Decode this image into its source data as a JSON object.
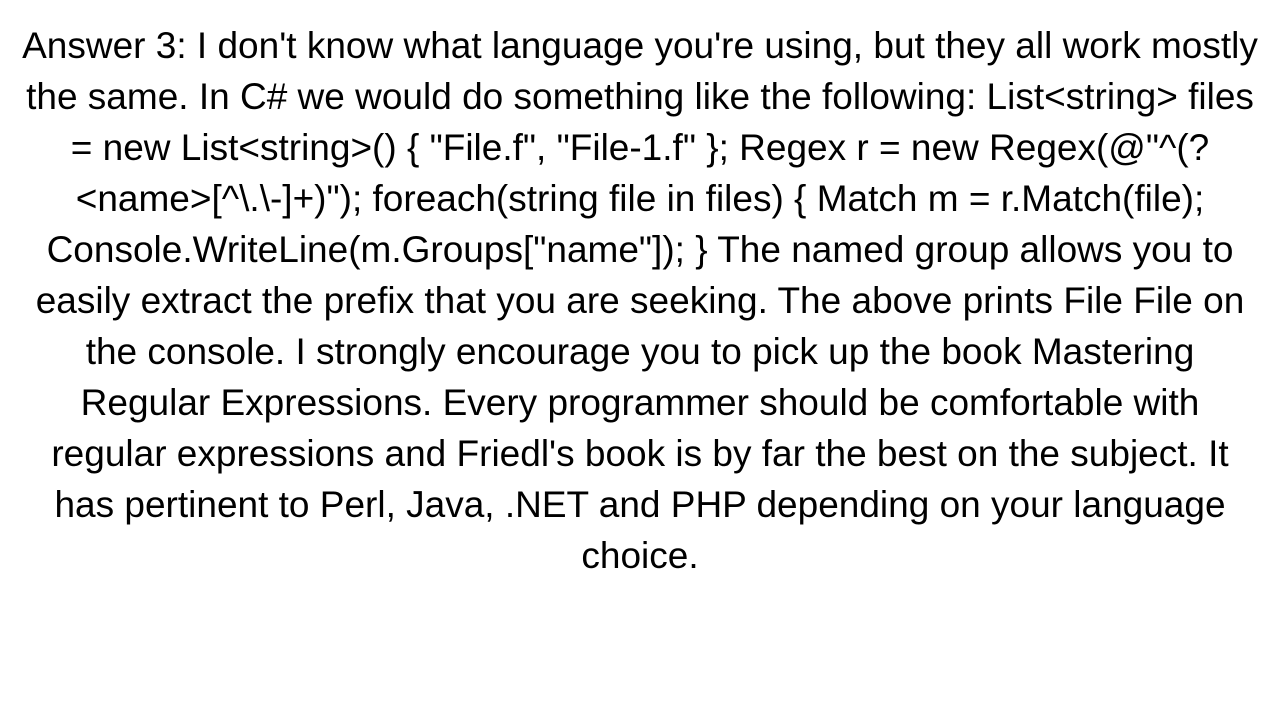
{
  "answer": {
    "text": "Answer 3: I don't know what language you're using, but they all work mostly the same. In C# we would do something like the following: List<string> files = new List<string>() { \"File.f\",     \"File-1.f\" }; Regex r = new Regex(@\"^(?<name>[^\\.\\-]+)\"); foreach(string file in files) {     Match m = r.Match(file);     Console.WriteLine(m.Groups[\"name\"]); }  The named group allows you to easily extract the prefix that you are seeking. The above prints File File  on the console. I strongly encourage you to pick up the book Mastering Regular Expressions. Every programmer should be comfortable with regular expressions and Friedl's book is by far the best on the subject. It has pertinent to Perl, Java, .NET and PHP depending on your language choice."
  }
}
